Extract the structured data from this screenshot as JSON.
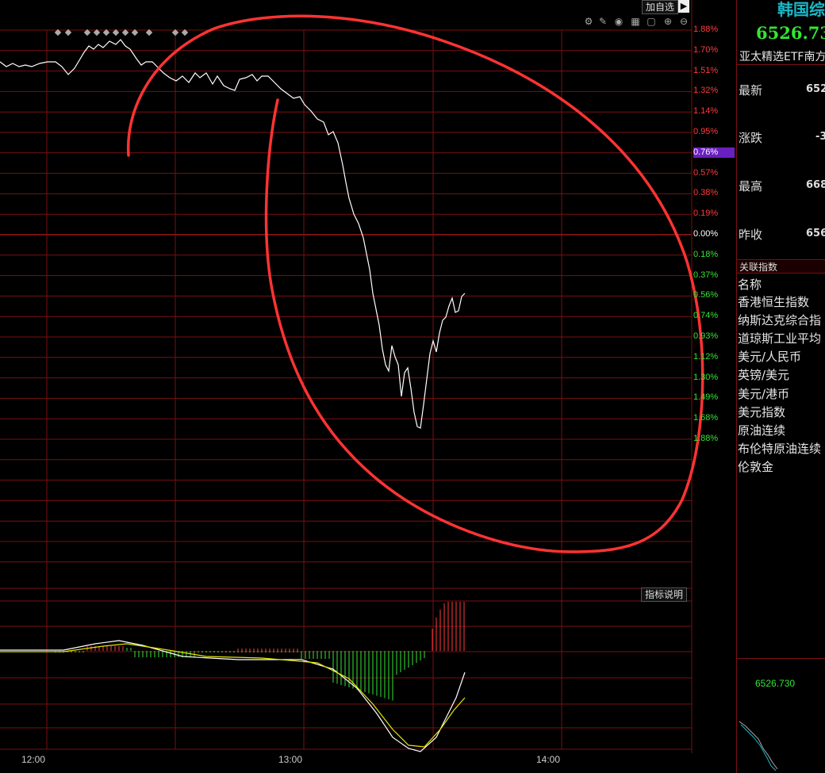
{
  "toolbar": {
    "add_watch_label": "加自选",
    "indicator_label": "指标说明"
  },
  "y_axis_labels": [
    {
      "text": "1.88%",
      "color": "#ff3c3c"
    },
    {
      "text": "1.70%",
      "color": "#ff3c3c"
    },
    {
      "text": "1.51%",
      "color": "#ff3c3c"
    },
    {
      "text": "1.32%",
      "color": "#ff3c3c"
    },
    {
      "text": "1.14%",
      "color": "#ff3c3c"
    },
    {
      "text": "0.95%",
      "color": "#ff3c3c"
    },
    {
      "text": "0.76%",
      "color": "#ff3c3c",
      "highlight": true
    },
    {
      "text": "0.57%",
      "color": "#ff3c3c"
    },
    {
      "text": "0.38%",
      "color": "#ff3c3c"
    },
    {
      "text": "0.19%",
      "color": "#ff3c3c"
    },
    {
      "text": "0.00%",
      "color": "#ffffff"
    },
    {
      "text": "0.18%",
      "color": "#33e633"
    },
    {
      "text": "0.37%",
      "color": "#33e633"
    },
    {
      "text": "0.56%",
      "color": "#33e633"
    },
    {
      "text": "0.74%",
      "color": "#33e633"
    },
    {
      "text": "0.93%",
      "color": "#33e633"
    },
    {
      "text": "1.12%",
      "color": "#33e633"
    },
    {
      "text": "1.30%",
      "color": "#33e633"
    },
    {
      "text": "1.49%",
      "color": "#33e633"
    },
    {
      "text": "1.68%",
      "color": "#33e633"
    },
    {
      "text": "1.88%",
      "color": "#33e633"
    }
  ],
  "x_ticks": [
    "12:00",
    "13:00",
    "14:00"
  ],
  "sidebar": {
    "title": "韩国综",
    "price": "6526.73",
    "subtitle": "亚太精选ETF南方",
    "rows": [
      {
        "label": "最新",
        "value": "652",
        "color": "#33e633"
      },
      {
        "label": "涨跌",
        "value": "-3",
        "color": "#33e633"
      },
      {
        "label": "最高",
        "value": "668",
        "color": "#ff4040"
      },
      {
        "label": "昨收",
        "value": "656",
        "color": "#ffffff"
      }
    ],
    "related_header": "关联指数",
    "related_col": "名称",
    "related_items": [
      "香港恒生指数",
      "纳斯达克综合指",
      "道琼斯工业平均",
      "美元/人民币",
      "英镑/美元",
      "美元/港币",
      "美元指数",
      "原油连续",
      "布伦特原油连续",
      "伦敦金"
    ],
    "mini_price": "6526.730"
  },
  "colors": {
    "grid": "#7a1010",
    "price_line": "#ffffff",
    "annotation": "#ff3333",
    "macd_up": "#ff3c3c",
    "macd_down": "#33e633",
    "dif": "#ffffff",
    "dea": "#e6e600",
    "sidebar_title": "#1ab8c8",
    "sidebar_price": "#33e633",
    "highlight": "#6a1fbf"
  }
}
